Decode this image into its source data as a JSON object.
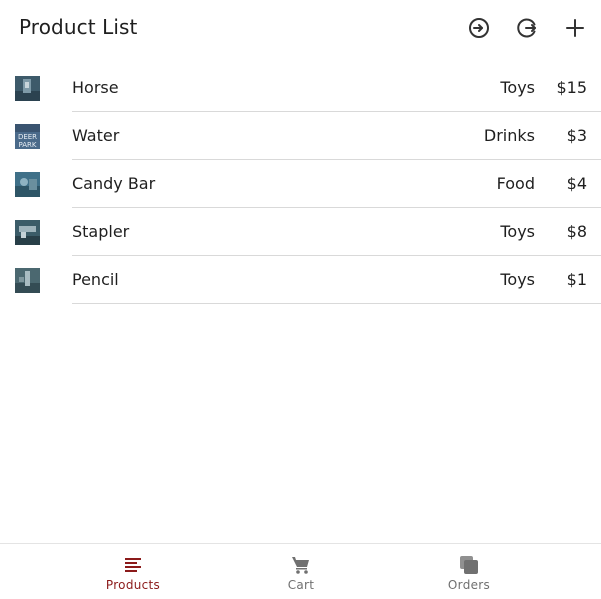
{
  "header": {
    "title": "Product List",
    "icons": [
      "login-icon",
      "logout-icon",
      "add-icon"
    ]
  },
  "products": [
    {
      "name": "Horse",
      "category": "Toys",
      "price": "$15",
      "thumb_color": "#3d5a6a"
    },
    {
      "name": "Water",
      "category": "Drinks",
      "price": "$3",
      "thumb_color": "#4a6a8a",
      "thumb_text_1": "DEER",
      "thumb_text_2": "PARK"
    },
    {
      "name": "Candy Bar",
      "category": "Food",
      "price": "$4",
      "thumb_color": "#3f7088"
    },
    {
      "name": "Stapler",
      "category": "Toys",
      "price": "$8",
      "thumb_color": "#3b5c68"
    },
    {
      "name": "Pencil",
      "category": "Toys",
      "price": "$1",
      "thumb_color": "#4b6870"
    }
  ],
  "tabs": [
    {
      "label": "Products",
      "icon": "list-icon",
      "active": true
    },
    {
      "label": "Cart",
      "icon": "cart-icon",
      "active": false
    },
    {
      "label": "Orders",
      "icon": "orders-icon",
      "active": false
    }
  ],
  "colors": {
    "active_tab": "#8b1a1a",
    "inactive_tab": "#707070",
    "icon": "#333333"
  }
}
